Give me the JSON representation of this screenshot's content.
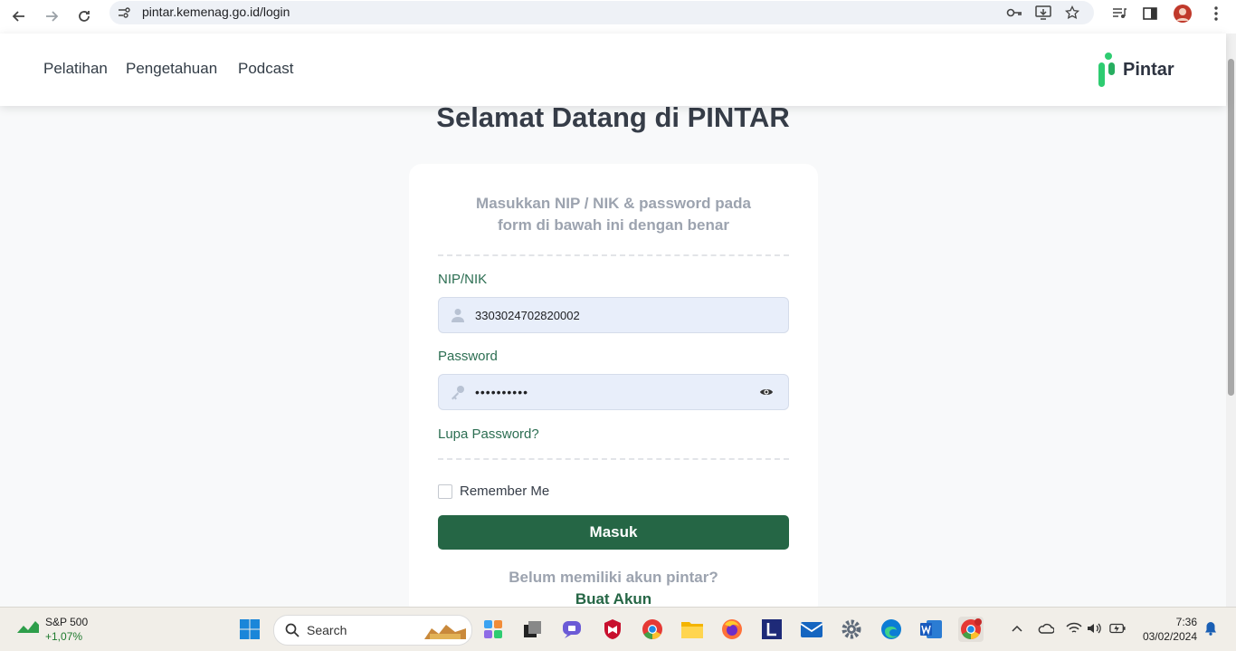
{
  "browser": {
    "url": "pintar.kemenag.go.id/login"
  },
  "header": {
    "nav": [
      {
        "label": "Pelatihan"
      },
      {
        "label": "Pengetahuan"
      },
      {
        "label": "Podcast"
      }
    ],
    "logo_text": "Pintar"
  },
  "main": {
    "title": "Selamat Datang di PINTAR",
    "intro_line1": "Masukkan NIP / NIK & password pada",
    "intro_line2": "form di bawah ini dengan benar",
    "nip_label": "NIP/NIK",
    "nip_value": "3303024702820002",
    "password_label": "Password",
    "password_value": "••••••••••",
    "forgot_label": "Lupa Password?",
    "remember_label": "Remember Me",
    "submit_label": "Masuk",
    "no_account_text": "Belum memiliki akun pintar?",
    "create_account_label": "Buat Akun"
  },
  "taskbar": {
    "stock_name": "S&P 500",
    "stock_change": "+1,07%",
    "search_label": "Search",
    "time": "7:36",
    "date": "03/02/2024"
  },
  "colors": {
    "brand_green": "#256645",
    "label_green": "#2c6e52",
    "logo_green": "#2ecc71"
  }
}
